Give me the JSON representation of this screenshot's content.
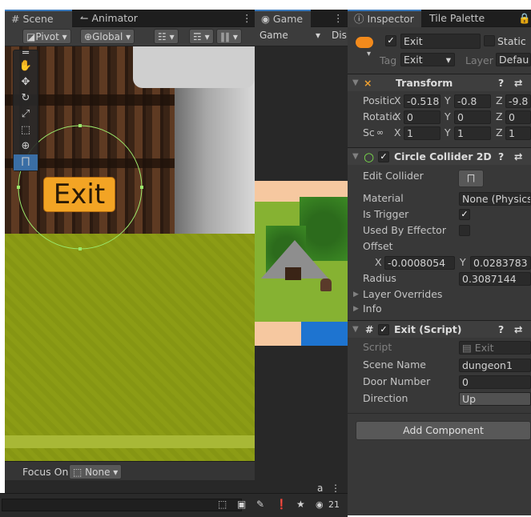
{
  "scene_tabs": {
    "scene": "Scene",
    "animator": "Animator"
  },
  "scene_toolbar": {
    "pivot": "Pivot",
    "global": "Global"
  },
  "overlay": {
    "exit_label": "Exit"
  },
  "focus": {
    "label": "Focus On",
    "value": "None"
  },
  "game_tabs": {
    "game": "Game",
    "dropdown": "Game",
    "display": "Dis"
  },
  "inspector_tabs": {
    "inspector": "Inspector",
    "tile_palette": "Tile Palette"
  },
  "object": {
    "name": "Exit",
    "static": "Static",
    "tag_label": "Tag",
    "tag": "Exit",
    "layer_label": "Layer",
    "layer": "Defau"
  },
  "transform": {
    "title": "Transform",
    "pos_label": "Positic",
    "rot_label": "Rotatic",
    "scale_label": "Sc",
    "pos_x": "-0.518",
    "pos_y": "-0.8",
    "pos_z": "-9.8",
    "rot_x": "0",
    "rot_y": "0",
    "rot_z": "0",
    "scale_x": "1",
    "scale_y": "1",
    "scale_z": "1"
  },
  "collider": {
    "title": "Circle Collider 2D",
    "edit": "Edit Collider",
    "material_label": "Material",
    "material": "None (Physics",
    "trigger": "Is Trigger",
    "effector": "Used By Effector",
    "offset": "Offset",
    "off_x": "-0.0008054",
    "off_y": "0.0283783",
    "radius_label": "Radius",
    "radius": "0.3087144",
    "overrides": "Layer Overrides",
    "info": "Info"
  },
  "script": {
    "title": "Exit (Script)",
    "script_label": "Script",
    "script": "Exit",
    "scene_label": "Scene Name",
    "scene": "dungeon1",
    "door_label": "Door Number",
    "door": "0",
    "dir_label": "Direction",
    "dir": "Up"
  },
  "add_component": "Add Component",
  "axes": {
    "x": "X",
    "y": "Y",
    "z": "Z"
  },
  "status": {
    "count": "21",
    "layout": "a"
  }
}
